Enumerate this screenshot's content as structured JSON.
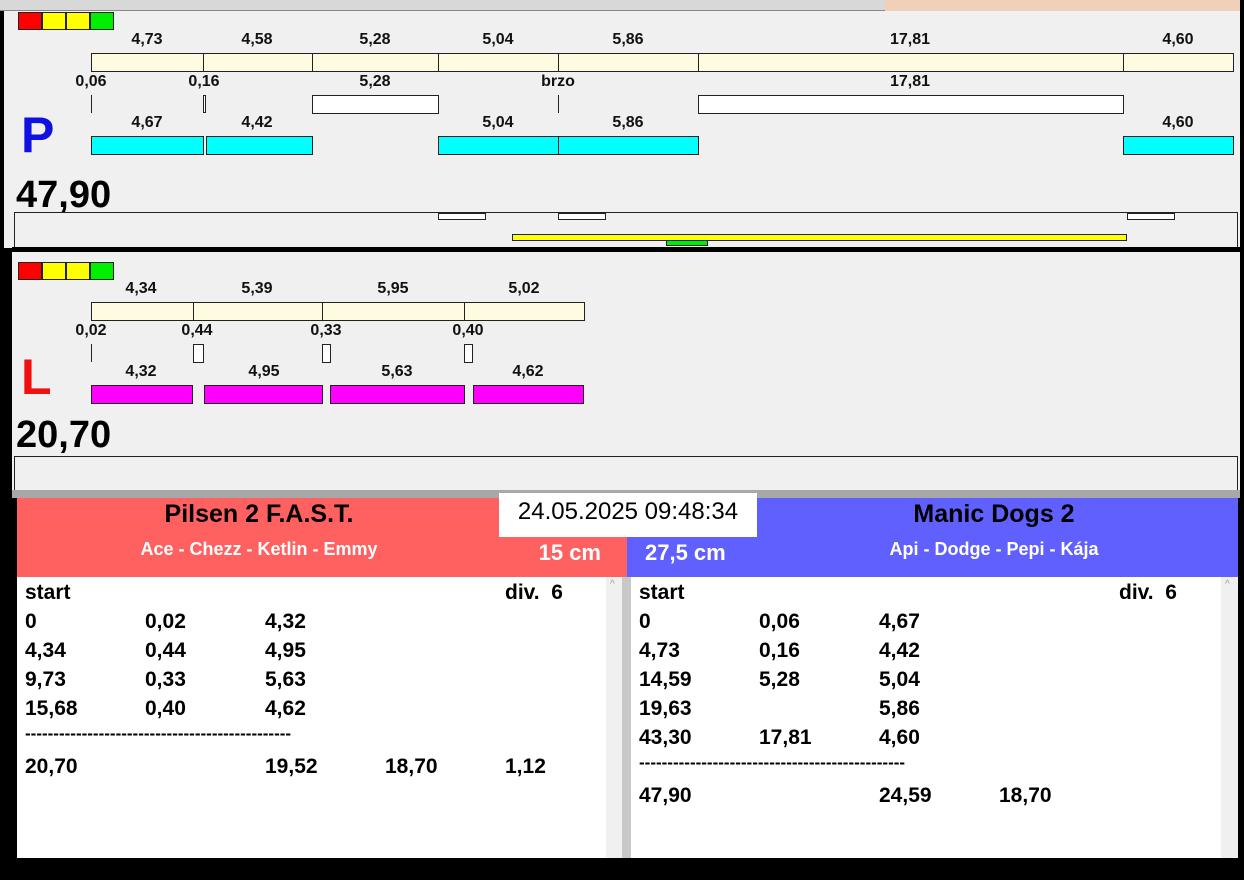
{
  "top_lane": {
    "letter": "P",
    "total": "47,90",
    "row1": [
      "4,73",
      "4,58",
      "5,28",
      "5,04",
      "5,86",
      "17,81",
      "4,60"
    ],
    "row2": [
      "0,06",
      "0,16",
      "5,28",
      "brzo",
      "17,81"
    ],
    "row3": [
      "4,67",
      "4,42",
      "5,04",
      "5,86",
      "4,60"
    ]
  },
  "bottom_lane": {
    "letter": "L",
    "total": "20,70",
    "row1": [
      "4,34",
      "5,39",
      "5,95",
      "5,02"
    ],
    "row2": [
      "0,02",
      "0,44",
      "0,33",
      "0,40"
    ],
    "row3": [
      "4,32",
      "4,95",
      "5,63",
      "4,62"
    ]
  },
  "datetime": "24.05.2025 09:48:34",
  "left_team": {
    "name": "Pilsen 2 F.A.S.T.",
    "dogs": "Ace - Chezz - Ketlin - Emmy",
    "height": "15 cm",
    "color": "#ff6060",
    "header": [
      "start",
      "div.  6"
    ],
    "rows": [
      [
        "0",
        "0,02",
        "4,32"
      ],
      [
        "4,34",
        "0,44",
        "4,95"
      ],
      [
        "9,73",
        "0,33",
        "5,63"
      ],
      [
        "15,68",
        "0,40",
        "4,62"
      ]
    ],
    "separator": "-----------------------------------------------",
    "totals": [
      "20,70",
      "19,52",
      "18,70",
      "1,12"
    ]
  },
  "right_team": {
    "name": "Manic Dogs 2",
    "dogs": "Api - Dodge - Pepi - Kája",
    "height": "27,5 cm",
    "color": "#6060ff",
    "header": [
      "start",
      "div.  6"
    ],
    "rows": [
      [
        "0",
        "0,06",
        "4,67"
      ],
      [
        "4,73",
        "0,16",
        "4,42"
      ],
      [
        "14,59",
        "5,28",
        "5,04"
      ],
      [
        "19,63",
        "",
        "5,86"
      ],
      [
        "43,30",
        "17,81",
        "4,60"
      ]
    ],
    "separator": "-----------------------------------------------",
    "totals": [
      "47,90",
      "24,59",
      "18,70"
    ]
  }
}
